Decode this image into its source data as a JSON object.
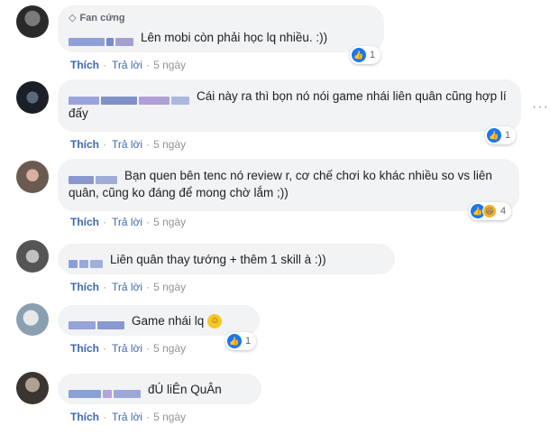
{
  "comments": [
    {
      "badge": "Fan cứng",
      "text": "Lên mobi còn phải học lq nhiều. :))",
      "actions": {
        "like": "Thích",
        "reply": "Trả lời",
        "time": "5 ngày"
      },
      "reaction_count": "1"
    },
    {
      "text": "Cái này ra thì bọn nó nói game nhái liên quân cũng hợp lí đấy",
      "actions": {
        "like": "Thích",
        "reply": "Trả lời",
        "time": "5 ngày"
      },
      "reaction_count": "1"
    },
    {
      "text": "Bạn quen bên tenc nó review r, cơ chế chơi ko khác nhiều so vs liên quân, cũng ko đáng để mong chờ lắm ;))",
      "actions": {
        "like": "Thích",
        "reply": "Trả lời",
        "time": "5 ngày"
      },
      "reaction_count": "4"
    },
    {
      "text": "Liên quân thay tướng + thêm 1 skill à :))",
      "actions": {
        "like": "Thích",
        "reply": "Trả lời",
        "time": "5 ngày"
      }
    },
    {
      "text": "Game nhái lq",
      "actions": {
        "like": "Thích",
        "reply": "Trả lời",
        "time": "5 ngày"
      },
      "reaction_count": "1"
    },
    {
      "text": "đÚ liÊn QuÂn",
      "actions": {
        "like": "Thích",
        "reply": "Trả lời",
        "time": "5 ngày"
      }
    }
  ],
  "icons": {
    "like": "thumbs-up-icon",
    "haha": "haha-reaction-icon",
    "more": "more-options-icon",
    "badge": "diamond-badge-icon"
  },
  "colors": {
    "link": "#4267b2",
    "bubble": "#f2f3f5",
    "muted": "#90949c",
    "like_blue": "#1877f2"
  }
}
